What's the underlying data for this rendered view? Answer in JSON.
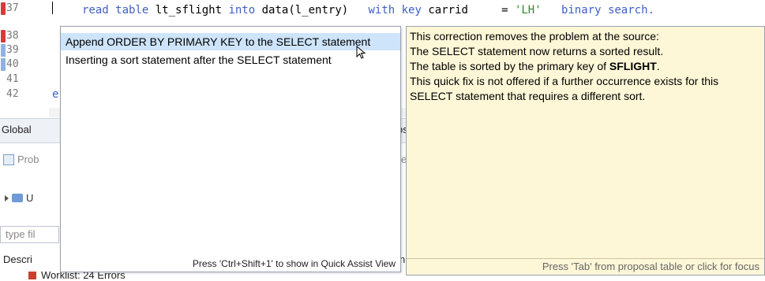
{
  "editor": {
    "line_numbers": [
      "37",
      "38",
      "39",
      "40",
      "41",
      "42"
    ],
    "line_37": {
      "kw1": "read table",
      "t1": " lt_sflight ",
      "kw2": "into",
      "t2": " data(l_entry)",
      "kw3": "with key",
      "t3": " carrid     = ",
      "str": "'LH'",
      "kw4": "binary search."
    },
    "line_42_text": "e"
  },
  "views": {
    "global_tab": "Global",
    "right_tab_fragment": "os",
    "problems_label": "Prob",
    "tree_label": "U",
    "filter_placeholder": "type fil",
    "description_header": "Descri",
    "description_fragment": "n",
    "worklist": "Worklist: 24 Errors",
    "right_edge_char": "a",
    "problems_fragment": "e"
  },
  "quickfix": {
    "proposals": [
      "Append ORDER BY PRIMARY KEY to the SELECT statement",
      "Inserting a sort statement after the SELECT statement"
    ],
    "footer": "Press 'Ctrl+Shift+1' to show in Quick Assist View"
  },
  "info": {
    "lines": [
      "This correction removes the problem at the source:",
      " The SELECT statement now returns a sorted result.",
      " The table is sorted by the primary key of ",
      " This quick fix is not offered if a further occurrence exists for this",
      " SELECT statement that requires a different sort."
    ],
    "bold_word": "SFLIGHT",
    "bold_tail": ".",
    "footer": "Press 'Tab' from proposal table or click for focus"
  }
}
